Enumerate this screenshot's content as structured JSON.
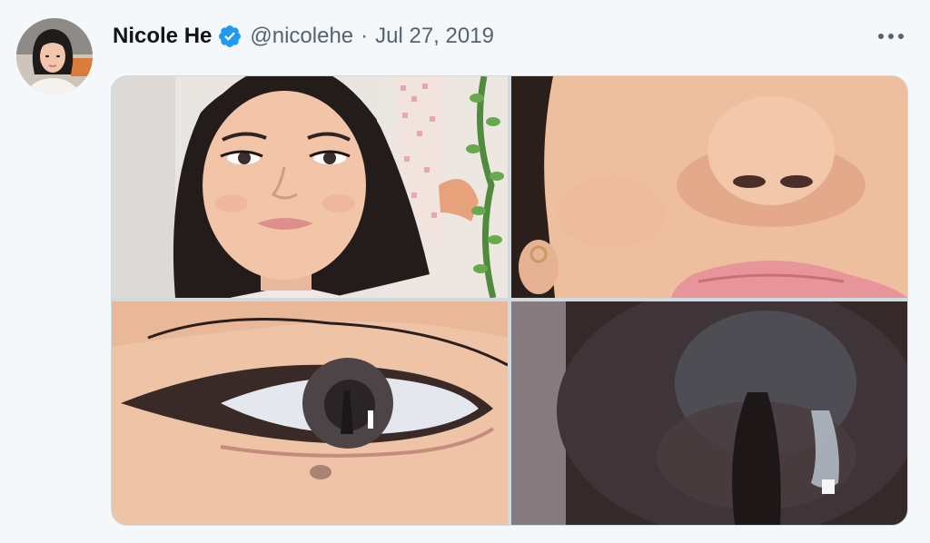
{
  "tweet": {
    "author_name": "Nicole He",
    "verified_icon": "verified-badge-icon",
    "handle": "@nicolehe",
    "separator": "·",
    "date": "Jul 27, 2019",
    "more_icon": "more-options-icon"
  },
  "media": {
    "photo_count": 4,
    "photos": [
      {
        "subject": "selfie-portrait"
      },
      {
        "subject": "closeup-nose-lips"
      },
      {
        "subject": "closeup-eye"
      },
      {
        "subject": "extreme-closeup-pupil"
      }
    ]
  },
  "colors": {
    "background": "#f5f8fa",
    "name": "#0f1419",
    "secondary_text": "#536471",
    "verified_blue": "#1d9bf0",
    "media_border": "#cfd9de"
  }
}
